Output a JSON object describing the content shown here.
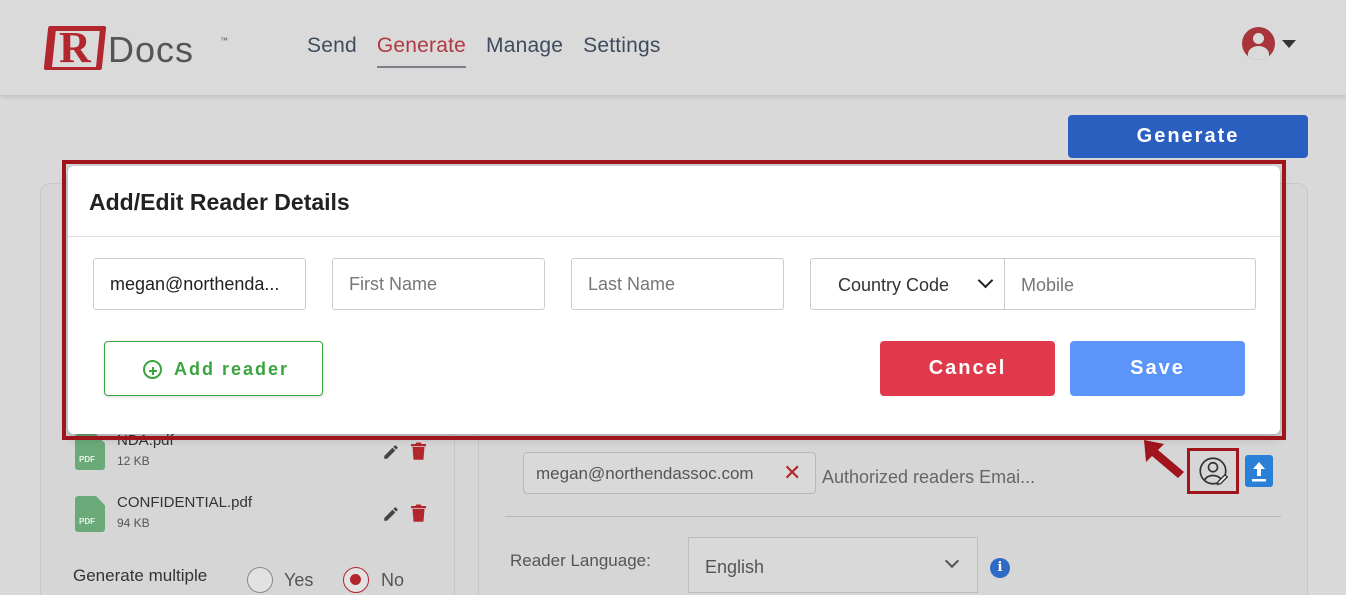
{
  "header": {
    "logo_r": "R",
    "logo_text": "Docs",
    "logo_tm": "™",
    "nav": [
      "Send",
      "Generate",
      "Manage",
      "Settings"
    ],
    "active_nav": "Generate"
  },
  "toolbar": {
    "generate_label": "Generate"
  },
  "files": [
    {
      "name": "NDA.pdf",
      "size": "12 KB"
    },
    {
      "name": "CONFIDENTIAL.pdf",
      "size": "94 KB"
    }
  ],
  "file_icon_label": "PDF",
  "generate_multiple": {
    "label": "Generate multiple",
    "yes": "Yes",
    "no": "No",
    "selected": "No"
  },
  "readers": {
    "chip_email": "megan@northendassoc.com",
    "placeholder": "Authorized readers Emai..."
  },
  "reader_language": {
    "label": "Reader Language:",
    "value": "English"
  },
  "modal": {
    "title": "Add/Edit Reader Details",
    "email_value": "megan@northenda...",
    "first_name_placeholder": "First Name",
    "last_name_placeholder": "Last Name",
    "country_code_label": "Country Code",
    "mobile_placeholder": "Mobile",
    "add_reader_label": "Add reader",
    "cancel_label": "Cancel",
    "save_label": "Save"
  },
  "colors": {
    "brand_red": "#b3262e",
    "primary_blue": "#2a5fbf",
    "cancel_red": "#e0394b",
    "save_blue": "#5b95f9",
    "success_green": "#3aa53f",
    "annotation_red": "#a0141c"
  },
  "icons": [
    "user-avatar-icon",
    "chevron-down-icon",
    "pdf-file-icon",
    "pencil-icon",
    "trash-icon",
    "close-icon",
    "reader-edit-icon",
    "upload-icon",
    "info-icon",
    "plus-circle-icon",
    "annotation-arrow"
  ]
}
